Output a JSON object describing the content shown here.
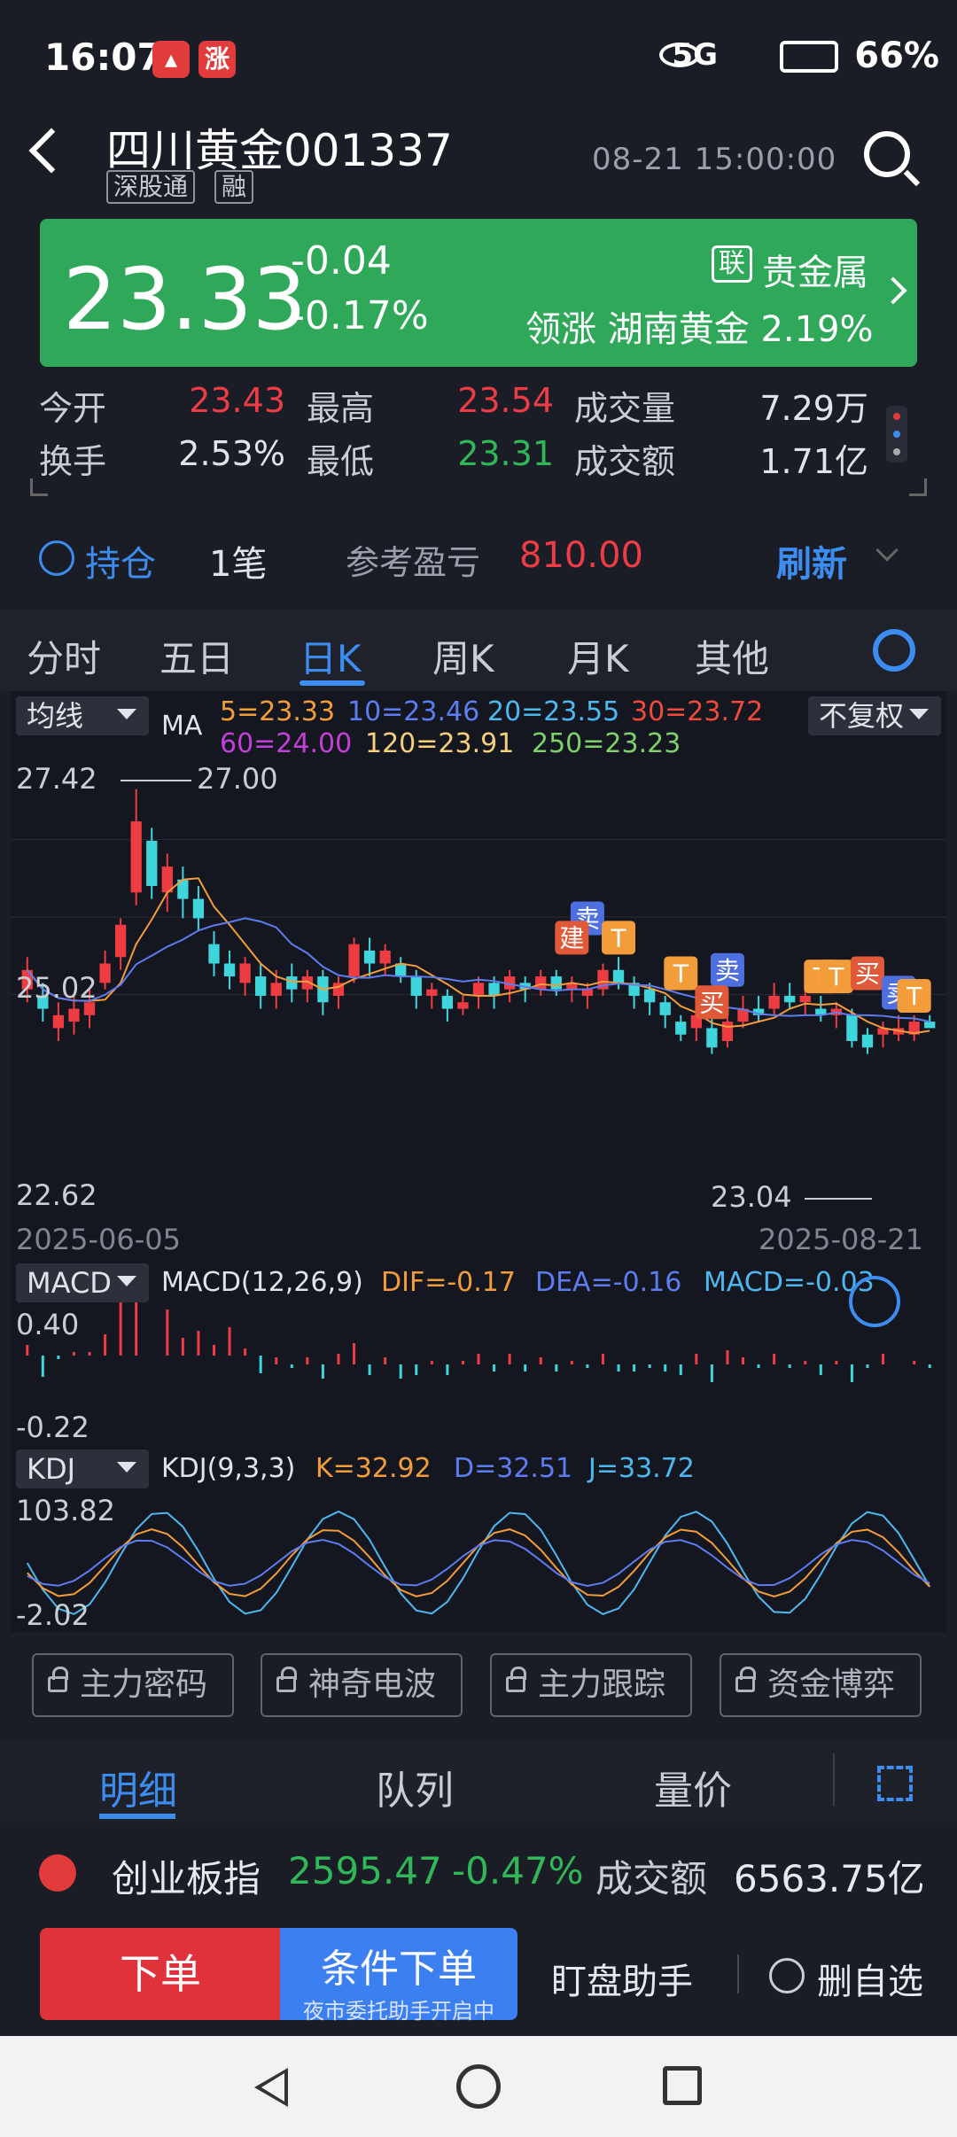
{
  "status_bar": {
    "time": "16:07",
    "signal": "5G",
    "battery": "66%"
  },
  "header": {
    "name": "四川黄金",
    "code": "001337",
    "tags": [
      "深股通",
      "融"
    ],
    "datetime": "08-21 15:00:00"
  },
  "price_card": {
    "price": "23.33",
    "change": "-0.04",
    "change_pct": "-0.17%",
    "sector_badge": "联",
    "sector": "贵金属",
    "leader_label": "领涨",
    "leader_name": "湖南黄金",
    "leader_pct": "2.19%"
  },
  "quote": {
    "open_label": "今开",
    "open": "23.43",
    "high_label": "最高",
    "high": "23.54",
    "vol_label": "成交量",
    "vol": "7.29万",
    "turnover_label": "换手",
    "turnover": "2.53%",
    "low_label": "最低",
    "low": "23.31",
    "amount_label": "成交额",
    "amount": "1.71亿"
  },
  "holdings": {
    "label": "持仓",
    "count": "1笔",
    "pnl_label": "参考盈亏",
    "pnl": "810.00",
    "refresh": "刷新"
  },
  "period_tabs": [
    "分时",
    "五日",
    "日K",
    "周K",
    "月K",
    "其他"
  ],
  "chart": {
    "ma_dropdown": "均线",
    "ma_label": "MA",
    "ma_values": {
      "ma5": "5=23.33",
      "ma10": "10=23.46",
      "ma20": "20=23.55",
      "ma30": "30=23.72",
      "ma60": "60=24.00",
      "ma120": "120=23.91",
      "ma250": "250=23.23"
    },
    "adjust": "不复权",
    "y_top": "27.42",
    "y_mid": "25.02",
    "y_bottom": "22.62",
    "high_marker": "27.00",
    "low_marker": "23.04",
    "date_start": "2025-06-05",
    "date_end": "2025-08-21",
    "signals": {
      "sell": "卖",
      "build": "建",
      "t": "T",
      "buy": "买"
    },
    "macd_dropdown": "MACD",
    "macd_params": "MACD(12,26,9)",
    "dif": "DIF=-0.17",
    "dea": "DEA=-0.16",
    "macd": "MACD=-0.03",
    "macd_top": "0.40",
    "macd_bottom": "-0.22",
    "kdj_dropdown": "KDJ",
    "kdj_params": "KDJ(9,3,3)",
    "k": "K=32.92",
    "d": "D=32.51",
    "j": "J=33.72",
    "kdj_top": "103.82",
    "kdj_bottom": "-2.02"
  },
  "chart_data": {
    "type": "candlestick",
    "title": "四川黄金 001337 日K",
    "x_range": [
      "2025-06-05",
      "2025-08-21"
    ],
    "ylim": [
      22.62,
      27.42
    ],
    "candles": [
      {
        "o": 23.9,
        "c": 24.2,
        "h": 24.4,
        "l": 23.7
      },
      {
        "o": 23.8,
        "c": 23.6,
        "h": 24.0,
        "l": 23.4
      },
      {
        "o": 23.3,
        "c": 23.5,
        "h": 23.7,
        "l": 23.1
      },
      {
        "o": 23.4,
        "c": 23.6,
        "h": 23.8,
        "l": 23.2
      },
      {
        "o": 23.5,
        "c": 23.7,
        "h": 23.9,
        "l": 23.3
      },
      {
        "o": 24.0,
        "c": 24.3,
        "h": 24.5,
        "l": 23.9
      },
      {
        "o": 24.4,
        "c": 24.9,
        "h": 25.0,
        "l": 24.2
      },
      {
        "o": 25.4,
        "c": 26.5,
        "h": 27.0,
        "l": 25.2
      },
      {
        "o": 26.2,
        "c": 25.5,
        "h": 26.4,
        "l": 25.3
      },
      {
        "o": 25.4,
        "c": 25.8,
        "h": 26.0,
        "l": 25.1
      },
      {
        "o": 25.6,
        "c": 25.3,
        "h": 25.8,
        "l": 25.0
      },
      {
        "o": 25.3,
        "c": 25.0,
        "h": 25.5,
        "l": 24.8
      },
      {
        "o": 24.6,
        "c": 24.3,
        "h": 24.8,
        "l": 24.1
      },
      {
        "o": 24.3,
        "c": 24.1,
        "h": 24.5,
        "l": 23.9
      },
      {
        "o": 24.0,
        "c": 24.3,
        "h": 24.4,
        "l": 23.8
      },
      {
        "o": 24.1,
        "c": 23.8,
        "h": 24.3,
        "l": 23.6
      },
      {
        "o": 23.8,
        "c": 24.0,
        "h": 24.2,
        "l": 23.6
      },
      {
        "o": 24.1,
        "c": 23.9,
        "h": 24.3,
        "l": 23.7
      },
      {
        "o": 23.9,
        "c": 24.1,
        "h": 24.2,
        "l": 23.7
      },
      {
        "o": 24.1,
        "c": 23.7,
        "h": 24.2,
        "l": 23.5
      },
      {
        "o": 23.8,
        "c": 24.0,
        "h": 24.1,
        "l": 23.6
      },
      {
        "o": 24.1,
        "c": 24.6,
        "h": 24.7,
        "l": 24.0
      },
      {
        "o": 24.5,
        "c": 24.3,
        "h": 24.7,
        "l": 24.1
      },
      {
        "o": 24.3,
        "c": 24.5,
        "h": 24.6,
        "l": 24.1
      },
      {
        "o": 24.3,
        "c": 24.1,
        "h": 24.4,
        "l": 24.0
      },
      {
        "o": 24.1,
        "c": 23.8,
        "h": 24.2,
        "l": 23.6
      },
      {
        "o": 23.8,
        "c": 23.9,
        "h": 24.0,
        "l": 23.6
      },
      {
        "o": 23.8,
        "c": 23.6,
        "h": 23.9,
        "l": 23.4
      },
      {
        "o": 23.6,
        "c": 23.7,
        "h": 23.8,
        "l": 23.5
      },
      {
        "o": 23.8,
        "c": 24.0,
        "h": 24.1,
        "l": 23.6
      },
      {
        "o": 24.0,
        "c": 23.8,
        "h": 24.1,
        "l": 23.6
      },
      {
        "o": 23.9,
        "c": 24.1,
        "h": 24.2,
        "l": 23.7
      },
      {
        "o": 24.0,
        "c": 23.9,
        "h": 24.1,
        "l": 23.7
      },
      {
        "o": 23.9,
        "c": 24.1,
        "h": 24.2,
        "l": 23.8
      },
      {
        "o": 24.1,
        "c": 23.9,
        "h": 24.2,
        "l": 23.8
      },
      {
        "o": 23.9,
        "c": 24.0,
        "h": 24.1,
        "l": 23.7
      },
      {
        "o": 23.8,
        "c": 23.9,
        "h": 24.0,
        "l": 23.6
      },
      {
        "o": 23.9,
        "c": 24.2,
        "h": 24.3,
        "l": 23.8
      },
      {
        "o": 24.2,
        "c": 24.0,
        "h": 24.4,
        "l": 23.9
      },
      {
        "o": 24.0,
        "c": 23.8,
        "h": 24.1,
        "l": 23.6
      },
      {
        "o": 23.9,
        "c": 23.7,
        "h": 24.0,
        "l": 23.5
      },
      {
        "o": 23.7,
        "c": 23.5,
        "h": 23.8,
        "l": 23.3
      },
      {
        "o": 23.4,
        "c": 23.2,
        "h": 23.5,
        "l": 23.1
      },
      {
        "o": 23.3,
        "c": 23.5,
        "h": 23.6,
        "l": 23.1
      },
      {
        "o": 23.3,
        "c": 23.0,
        "h": 23.5,
        "l": 22.9
      },
      {
        "o": 23.1,
        "c": 23.4,
        "h": 23.5,
        "l": 23.0
      },
      {
        "o": 23.4,
        "c": 23.6,
        "h": 23.8,
        "l": 23.3
      },
      {
        "o": 23.6,
        "c": 23.5,
        "h": 23.8,
        "l": 23.4
      },
      {
        "o": 23.6,
        "c": 23.8,
        "h": 24.0,
        "l": 23.5
      },
      {
        "o": 23.8,
        "c": 23.7,
        "h": 24.0,
        "l": 23.6
      },
      {
        "o": 23.7,
        "c": 23.8,
        "h": 23.9,
        "l": 23.5
      },
      {
        "o": 23.6,
        "c": 23.5,
        "h": 23.8,
        "l": 23.4
      },
      {
        "o": 23.5,
        "c": 23.6,
        "h": 23.7,
        "l": 23.3
      },
      {
        "o": 23.5,
        "c": 23.1,
        "h": 23.6,
        "l": 23.0
      },
      {
        "o": 23.2,
        "c": 23.0,
        "h": 23.3,
        "l": 22.9
      },
      {
        "o": 23.2,
        "c": 23.3,
        "h": 23.4,
        "l": 23.0
      },
      {
        "o": 23.2,
        "c": 23.3,
        "h": 23.5,
        "l": 23.1
      },
      {
        "o": 23.2,
        "c": 23.4,
        "h": 23.5,
        "l": 23.1
      },
      {
        "o": 23.4,
        "c": 23.3,
        "h": 23.5,
        "l": 23.3
      }
    ]
  },
  "tools": [
    "主力密码",
    "神奇电波",
    "主力跟踪",
    "资金博弈"
  ],
  "detail_tabs": [
    "明细",
    "队列",
    "量价"
  ],
  "ticker": {
    "name": "创业板指",
    "value": "2595.47",
    "pct": "-0.47%",
    "amount_label": "成交额",
    "amount": "6563.75亿"
  },
  "actions": {
    "order": "下单",
    "cond_order": "条件下单",
    "cond_sub": "夜市委托助手开启中",
    "watch": "盯盘助手",
    "remove": "删自选"
  }
}
